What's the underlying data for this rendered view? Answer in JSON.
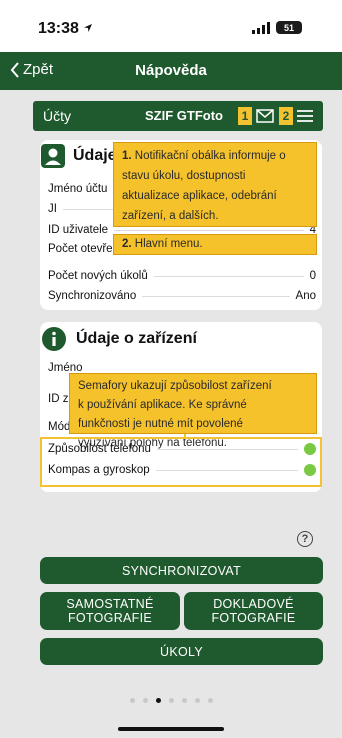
{
  "status": {
    "time": "13:38",
    "battery": "51"
  },
  "nav": {
    "back_label": "Zpět",
    "title": "Nápověda"
  },
  "app_header": {
    "left_label": "Účty",
    "app_name": "SZIF GTFoto",
    "badge1": "1",
    "badge2": "2"
  },
  "user_card": {
    "title": "Údaje",
    "rows": [
      {
        "label": "Jméno účtu",
        "value": ""
      },
      {
        "label": "JI",
        "value": ""
      },
      {
        "label": "ID uživatele",
        "value": "4"
      },
      {
        "label": "Počet otevřených úkolů",
        "value": "0"
      },
      {
        "label": "Počet nových úkolů",
        "value": "0"
      },
      {
        "label": "Synchronizováno",
        "value": "Ano"
      }
    ]
  },
  "tooltip1": {
    "number": "1.",
    "lines": [
      "Notifikační obálka informuje o",
      "stavu úkolu, dostupnosti",
      "aktualizace aplikace, odebrání",
      "zařízení, a dalších."
    ]
  },
  "tooltip2": {
    "number": "2.",
    "text": "Hlavní menu."
  },
  "device_card": {
    "title": "Údaje o zařízení",
    "rows": [
      {
        "label": "Jméno",
        "value": ""
      },
      {
        "label": "ID z",
        "value": ""
      },
      {
        "label": "Mód",
        "value": ""
      }
    ],
    "status_rows": [
      {
        "label": "Způsobilost telefonu",
        "status": "ok"
      },
      {
        "label": "Kompas a gyroskop",
        "status": "ok"
      }
    ]
  },
  "tooltip3": {
    "lines": [
      "Semafory ukazují způsobilost zařízení",
      "k používání aplikace. Ke správné",
      "funkčnosti je nutné mít povolené",
      "využívání polohy na telefonu."
    ]
  },
  "buttons": {
    "sync": "SYNCHRONIZOVAT",
    "standalone": [
      "SAMOSTATNÉ",
      "FOTOGRAFIE"
    ],
    "evidence": [
      "DOKLADOVÉ",
      "FOTOGRAFIE"
    ],
    "tasks": "ÚKOLY"
  },
  "colors": {
    "brand_green": "#1f5a2e",
    "highlight_yellow": "#f5c22c",
    "status_green": "#7ac943"
  }
}
